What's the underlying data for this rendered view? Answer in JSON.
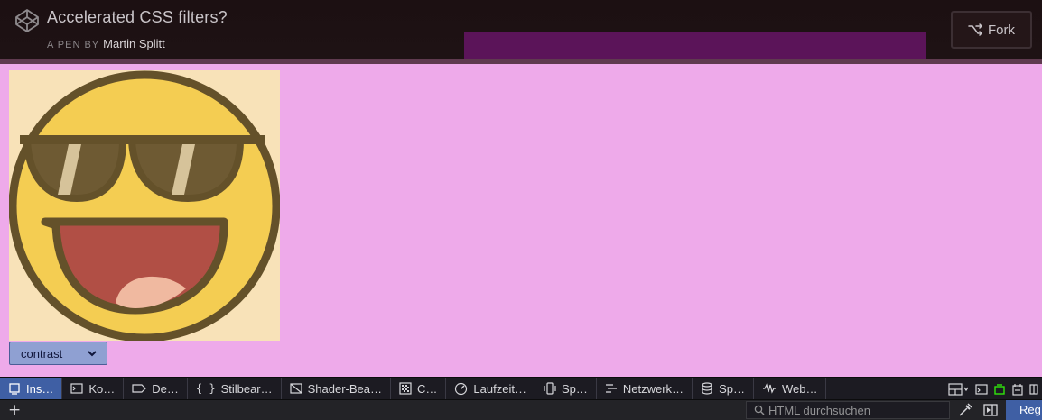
{
  "header": {
    "title": "Accelerated CSS filters?",
    "byline_prefix": "A PEN BY",
    "author": "Martin Splitt",
    "fork_label": "Fork",
    "logo_icon": "codepen-logo-icon",
    "fork_icon": "fork-icon"
  },
  "preview": {
    "background": "#eeaaea",
    "image_icon": "sunglasses-smiley-icon",
    "filter_select": {
      "value": "contrast",
      "icon": "chevron-down-icon"
    }
  },
  "devtools": {
    "tabs": [
      {
        "label": "Ins…",
        "icon": "inspector-icon",
        "active": true
      },
      {
        "label": "Ko…",
        "icon": "console-icon",
        "active": false
      },
      {
        "label": "De…",
        "icon": "debugger-icon",
        "active": false
      },
      {
        "label": "Stilbear…",
        "icon": "style-editor-icon",
        "active": false
      },
      {
        "label": "Shader-Bea…",
        "icon": "shader-editor-icon",
        "active": false
      },
      {
        "label": "C…",
        "icon": "canvas-icon",
        "active": false
      },
      {
        "label": "Laufzeit…",
        "icon": "performance-icon",
        "active": false
      },
      {
        "label": "Sp…",
        "icon": "memory-icon",
        "active": false
      },
      {
        "label": "Netzwerk…",
        "icon": "network-icon",
        "active": false
      },
      {
        "label": "Sp…",
        "icon": "storage-icon",
        "active": false
      },
      {
        "label": "Web…",
        "icon": "webaudio-icon",
        "active": false
      }
    ],
    "search_placeholder": "HTML durchsuchen",
    "rules_tab": "Reg"
  },
  "colors": {
    "header_bg": "#1c1012",
    "highlight": "#5b1459",
    "active_tab": "#3f5fa4",
    "select_bg": "#8fa0d2"
  }
}
